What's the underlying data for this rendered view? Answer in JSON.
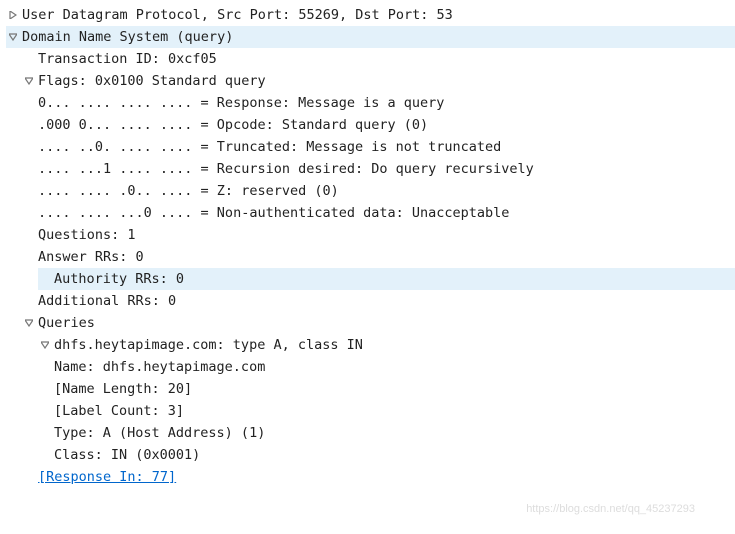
{
  "udp": {
    "line": "User Datagram Protocol, Src Port: 55269, Dst Port: 53"
  },
  "dns": {
    "title": "Domain Name System (query)",
    "transaction_id": "Transaction ID: 0xcf05",
    "flags": {
      "summary": "Flags: 0x0100 Standard query",
      "lines": [
        "0... .... .... .... = Response: Message is a query",
        ".000 0... .... .... = Opcode: Standard query (0)",
        ".... ..0. .... .... = Truncated: Message is not truncated",
        ".... ...1 .... .... = Recursion desired: Do query recursively",
        ".... .... .0.. .... = Z: reserved (0)",
        ".... .... ...0 .... = Non-authenticated data: Unacceptable"
      ]
    },
    "questions": "Questions: 1",
    "answer_rrs": "Answer RRs: 0",
    "authority_rrs": "Authority RRs: 0",
    "additional_rrs": "Additional RRs: 0",
    "queries": {
      "label": "Queries",
      "items": [
        {
          "summary": "dhfs.heytapimage.com: type A, class IN",
          "fields": [
            "Name: dhfs.heytapimage.com",
            "[Name Length: 20]",
            "[Label Count: 3]",
            "Type: A (Host Address) (1)",
            "Class: IN (0x0001)"
          ]
        }
      ]
    },
    "response_in": "[Response In: 77]"
  },
  "watermark": "https://blog.csdn.net/qq_45237293"
}
